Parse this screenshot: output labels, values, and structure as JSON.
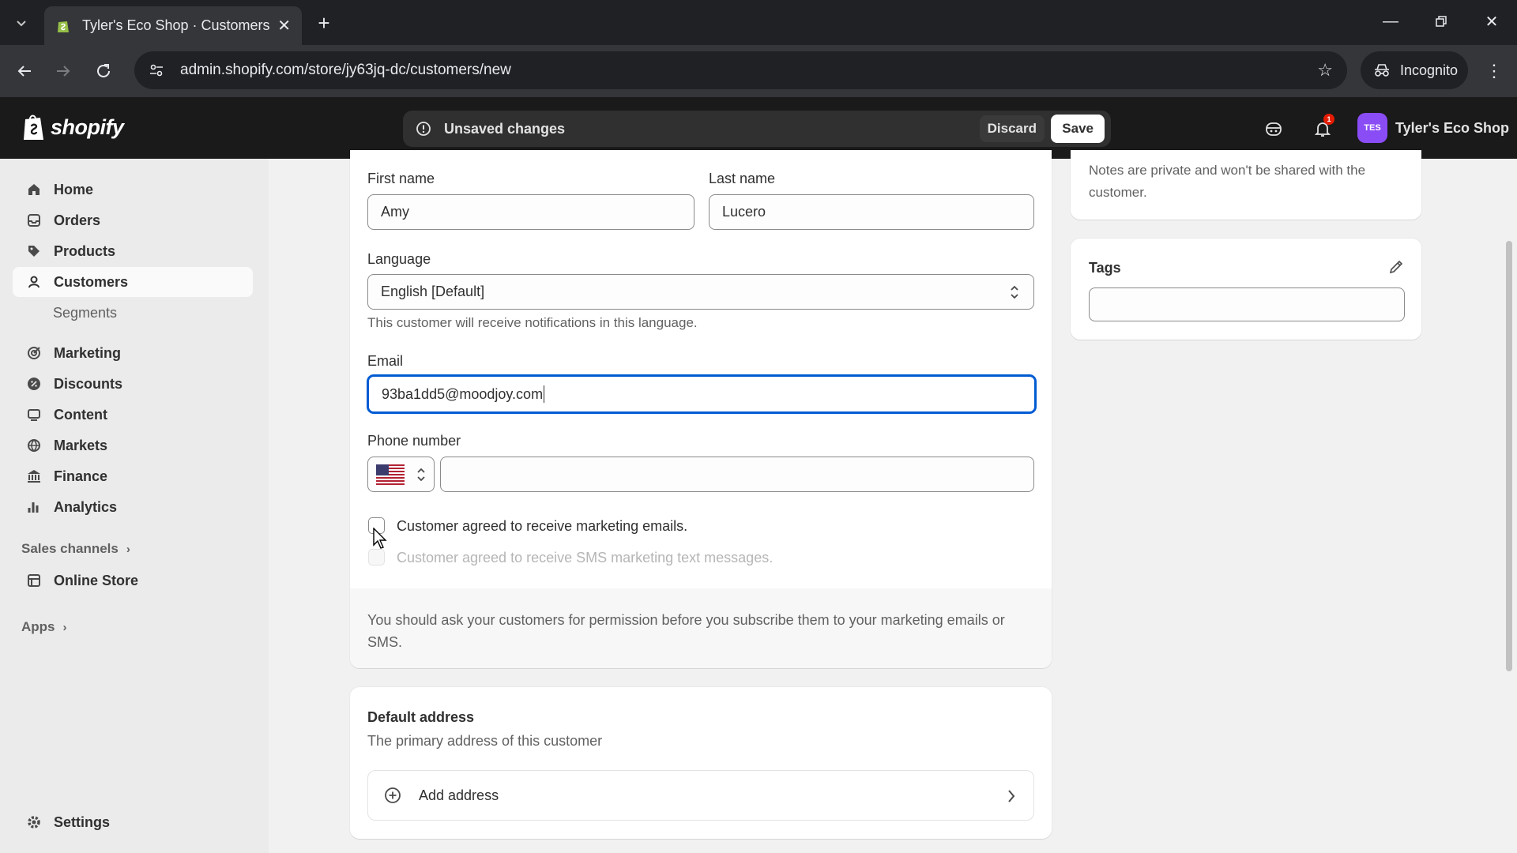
{
  "browser": {
    "tab_title": "Tyler's Eco Shop · Customers · N",
    "url": "admin.shopify.com/store/jy63jq-dc/customers/new",
    "incognito_label": "Incognito"
  },
  "topbar": {
    "logo_text": "shopify",
    "unsaved_message": "Unsaved changes",
    "discard_label": "Discard",
    "save_label": "Save",
    "notification_count": "1",
    "store_initials": "TES",
    "store_name": "Tyler's Eco Shop"
  },
  "sidebar": {
    "items": [
      {
        "label": "Home",
        "icon": "home-icon"
      },
      {
        "label": "Orders",
        "icon": "inbox-icon"
      },
      {
        "label": "Products",
        "icon": "tag-icon"
      },
      {
        "label": "Customers",
        "icon": "person-icon"
      },
      {
        "label": "Segments",
        "icon": ""
      },
      {
        "label": "Marketing",
        "icon": "target-icon"
      },
      {
        "label": "Discounts",
        "icon": "discount-icon"
      },
      {
        "label": "Content",
        "icon": "content-icon"
      },
      {
        "label": "Markets",
        "icon": "globe-icon"
      },
      {
        "label": "Finance",
        "icon": "bank-icon"
      },
      {
        "label": "Analytics",
        "icon": "chart-icon"
      },
      {
        "label": "Online Store",
        "icon": "store-icon"
      },
      {
        "label": "Settings",
        "icon": "gear-icon"
      }
    ],
    "sales_channels": "Sales channels",
    "apps": "Apps"
  },
  "form": {
    "first_name_label": "First name",
    "first_name_value": "Amy",
    "last_name_label": "Last name",
    "last_name_value": "Lucero",
    "language_label": "Language",
    "language_value": "English [Default]",
    "language_help": "This customer will receive notifications in this language.",
    "email_label": "Email",
    "email_value": "93ba1dd5@moodjoy.com",
    "phone_label": "Phone number",
    "phone_value": "",
    "marketing_email_label": "Customer agreed to receive marketing emails.",
    "marketing_sms_label": "Customer agreed to receive SMS marketing text messages.",
    "permission_note": "You should ask your customers for permission before you subscribe them to your marketing emails or SMS."
  },
  "address": {
    "title": "Default address",
    "subtitle": "The primary address of this customer",
    "add_label": "Add address"
  },
  "notes": {
    "text": "Notes are private and won't be shared with the customer."
  },
  "tags": {
    "title": "Tags",
    "value": ""
  }
}
